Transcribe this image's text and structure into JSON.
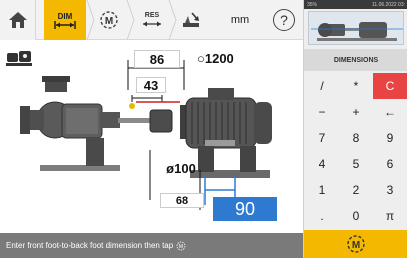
{
  "toolbar": {
    "dim_label": "DIM",
    "res_label": "RES",
    "unit": "mm",
    "help": "?"
  },
  "drawing": {
    "coupling_diameter": "86",
    "rpm": "1200",
    "rpm_prefix": "○",
    "coupling_center_to_front_foot": "43",
    "front_foot_diameter": "ø100",
    "front_foot_value": "68",
    "active_value": "90"
  },
  "status": {
    "message": "Enter front foot-to-back foot dimension then tap"
  },
  "right_panel": {
    "battery": "35%",
    "datetime": "11.06.2022 03:",
    "header": "DIMENSIONS",
    "keys": [
      "/",
      "*",
      "C",
      "−",
      "+",
      "←",
      "7",
      "8",
      "9",
      "4",
      "5",
      "6",
      "1",
      "2",
      "3",
      ".",
      "0",
      "π"
    ]
  },
  "colors": {
    "accent": "#f5b800",
    "active": "#2e7ad1",
    "clear": "#e84444",
    "status_bg": "#7a7a7a"
  },
  "icons": [
    "home-icon",
    "dimensions-icon",
    "measure-m-icon",
    "results-icon",
    "machine-icon",
    "help-icon",
    "confirm-m-icon"
  ]
}
